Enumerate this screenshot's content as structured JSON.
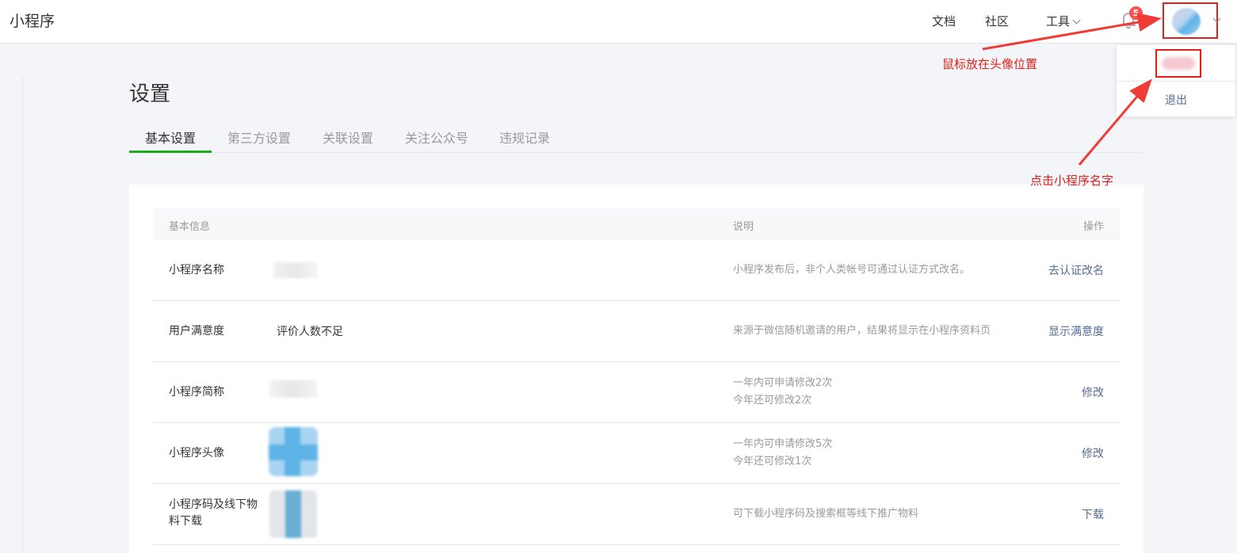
{
  "app": {
    "title": "小程序"
  },
  "header": {
    "nav": {
      "docs": "文档",
      "community": "社区",
      "tools": "工具"
    },
    "notification_count": "5",
    "icons": {
      "bell": "bell-icon",
      "chevron": "chevron-down-icon"
    }
  },
  "dropdown": {
    "logout": "退出"
  },
  "page": {
    "title": "设置",
    "tabs": [
      "基本设置",
      "第三方设置",
      "关联设置",
      "关注公众号",
      "违规记录"
    ]
  },
  "table": {
    "headers": {
      "basic": "基本信息",
      "desc": "说明",
      "op": "操作"
    },
    "rows": [
      {
        "label": "小程序名称",
        "value": "",
        "desc": [
          "小程序发布后，非个人类帐号可通过认证方式改名。"
        ],
        "op": "去认证改名"
      },
      {
        "label": "用户满意度",
        "value": "评价人数不足",
        "desc": [
          "来源于微信随机邀请的用户，结果将显示在小程序资料页"
        ],
        "op": "显示满意度"
      },
      {
        "label": "小程序简称",
        "value": "",
        "desc": [
          "一年内可申请修改2次",
          "今年还可修改2次"
        ],
        "op": "修改"
      },
      {
        "label": "小程序头像",
        "value": "",
        "desc": [
          "一年内可申请修改5次",
          "今年还可修改1次"
        ],
        "op": "修改"
      },
      {
        "label": "小程序码及线下物料下载",
        "value": "",
        "desc": [
          "可下载小程序码及搜索框等线下推广物料"
        ],
        "op": "下载"
      }
    ]
  },
  "annotations": {
    "hover_avatar": "鼠标放在头像位置",
    "click_name": "点击小程序名字"
  },
  "colors": {
    "accent_green": "#1aad19",
    "link_blue": "#576b95",
    "annotation_red": "#e0201a",
    "badge_red": "#fa5151"
  }
}
